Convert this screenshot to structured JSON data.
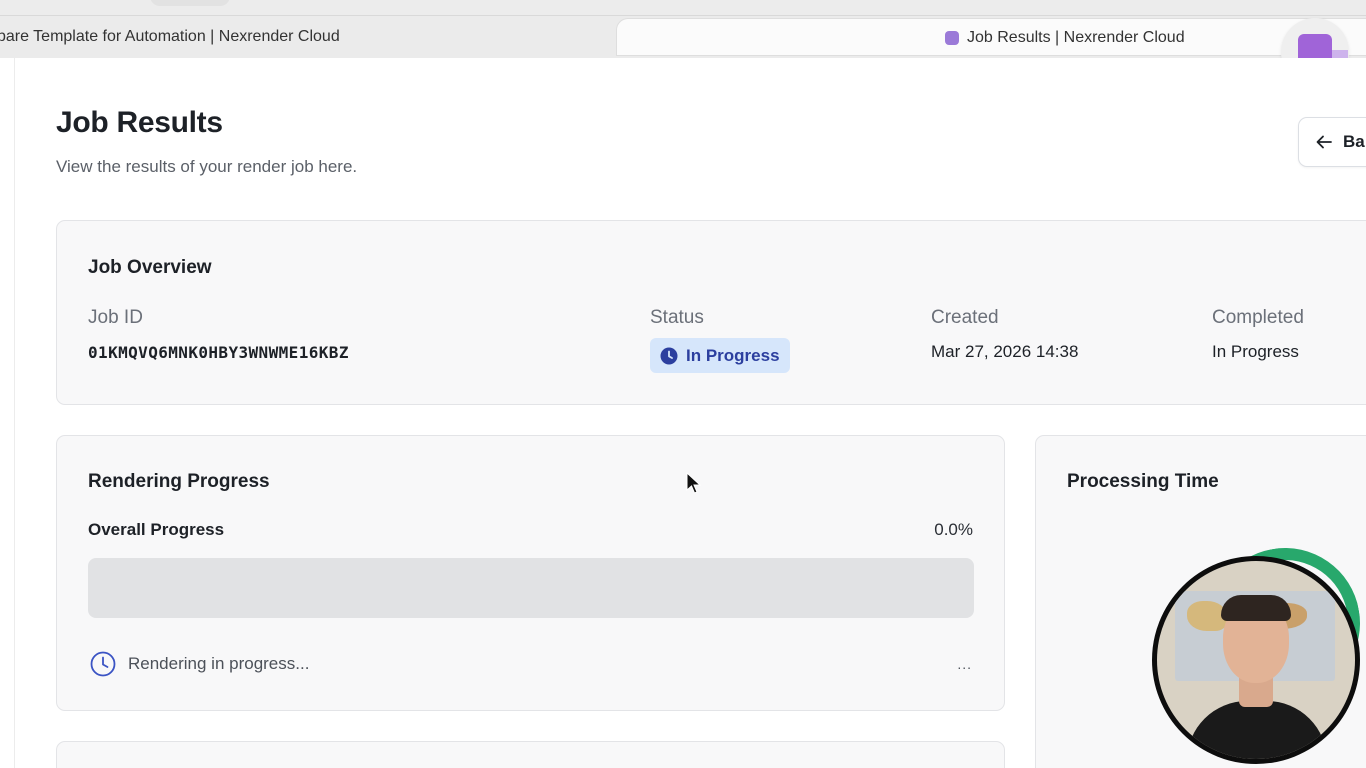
{
  "browser": {
    "inactive_tab_title": "pare Template for Automation | Nexrender Cloud",
    "active_tab_title": "Job Results | Nexrender Cloud"
  },
  "header": {
    "title": "Job Results",
    "subtitle": "View the results of your render job here.",
    "back_label": "Ba"
  },
  "overview": {
    "title": "Job Overview",
    "job_id_label": "Job ID",
    "job_id": "01KMQVQ6MNK0HBY3WNWME16KBZ",
    "status_label": "Status",
    "status": "In Progress",
    "created_label": "Created",
    "created": "Mar 27, 2026 14:38",
    "completed_label": "Completed",
    "completed": "In Progress"
  },
  "progress": {
    "title": "Rendering Progress",
    "overall_label": "Overall Progress",
    "overall_value": "0.0%",
    "fraction": 0.0,
    "status_text": "Rendering in progress...",
    "trailing": "..."
  },
  "processing_time": {
    "title": "Processing Time"
  },
  "colors": {
    "accent": "#3b54c4",
    "badge_bg": "#d6e6fb",
    "badge_text": "#2c3f9f",
    "favicon": "#9b7ad8"
  }
}
